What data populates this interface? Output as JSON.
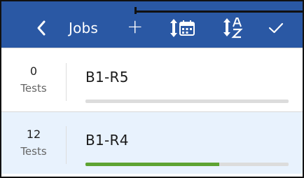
{
  "toolbar": {
    "title": "Jobs",
    "back_icon": "chevron-left-icon",
    "add_icon": "plus-icon",
    "add_glyph": "+",
    "calendar_sort_icon": "sort-by-date-icon",
    "alpha_sort_icon": "sort-alphabetical-icon",
    "confirm_icon": "check-icon",
    "bg_color": "#2a58a4"
  },
  "jobs": [
    {
      "count": "0",
      "count_label": "Tests",
      "name": "B1-R5",
      "progress": 0.0
    },
    {
      "count": "12",
      "count_label": "Tests",
      "name": "B1-R4",
      "progress": 0.66
    }
  ],
  "colors": {
    "progress_fill": "#5da331",
    "progress_track": "#dcdcdc",
    "selected_row": "#e8f2fd"
  }
}
